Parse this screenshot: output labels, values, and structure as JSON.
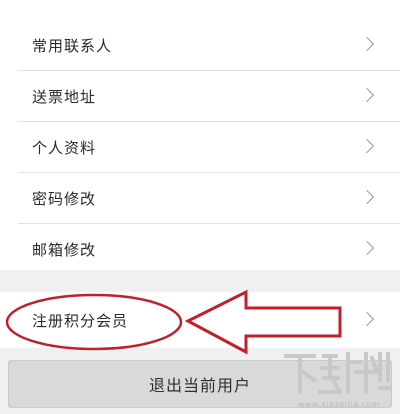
{
  "menu": {
    "items": [
      {
        "label": "常用联系人"
      },
      {
        "label": "送票地址"
      },
      {
        "label": "个人资料"
      },
      {
        "label": "密码修改"
      },
      {
        "label": "邮箱修改"
      }
    ]
  },
  "member": {
    "label": "注册积分会员"
  },
  "logout": {
    "label": "退出当前用户"
  },
  "watermark": {
    "url": "www.xiazaiba.com"
  },
  "colors": {
    "annotation": "#c0202a",
    "chevron": "#9a9a9a"
  },
  "icons": {
    "row_chevron": "chevron-right-icon"
  }
}
